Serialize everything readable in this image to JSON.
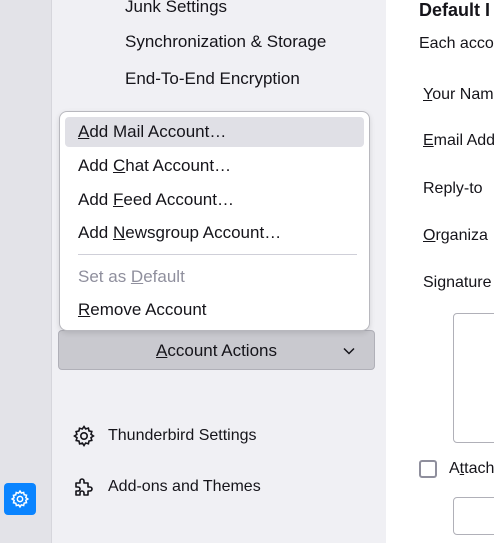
{
  "sidebar": {
    "tree_items": [
      {
        "label": "Junk Settings"
      },
      {
        "label": "Synchronization & Storage"
      },
      {
        "label": "End-To-End Encryption"
      }
    ],
    "account_actions": {
      "pre": "",
      "u": "A",
      "post": "ccount Actions"
    },
    "footer": [
      {
        "label": "Thunderbird Settings",
        "icon": "gear-icon"
      },
      {
        "label": "Add-ons and Themes",
        "icon": "puzzle-icon"
      }
    ]
  },
  "menu": {
    "items": [
      {
        "pre": "",
        "u": "A",
        "post": "dd Mail Account…",
        "highlighted": true
      },
      {
        "pre": "Add ",
        "u": "C",
        "post": "hat Account…"
      },
      {
        "pre": "Add ",
        "u": "F",
        "post": "eed Account…"
      },
      {
        "pre": "Add ",
        "u": "N",
        "post": "ewsgroup Account…"
      }
    ],
    "items2": [
      {
        "pre": "Set as ",
        "u": "D",
        "post": "efault",
        "disabled": true
      },
      {
        "pre": "",
        "u": "R",
        "post": "emove Account"
      }
    ]
  },
  "content": {
    "title": "Default I",
    "desc": "Each acco",
    "labels": [
      {
        "pre": "",
        "u": "Y",
        "post": "our Nam"
      },
      {
        "pre": "",
        "u": "E",
        "post": "mail Add"
      },
      {
        "pre": "Reply-to",
        "u": "",
        "post": ""
      },
      {
        "pre": "",
        "u": "O",
        "post": "rganiza"
      },
      {
        "pre": "Signature",
        "u": "",
        "post": ""
      }
    ],
    "attach": {
      "pre": "A",
      "u": "t",
      "post": "tach"
    }
  },
  "colors": {
    "accent": "#0a84ff",
    "highlight": "#e0e0e6",
    "sidebar_bg": "#f0f0f4"
  }
}
